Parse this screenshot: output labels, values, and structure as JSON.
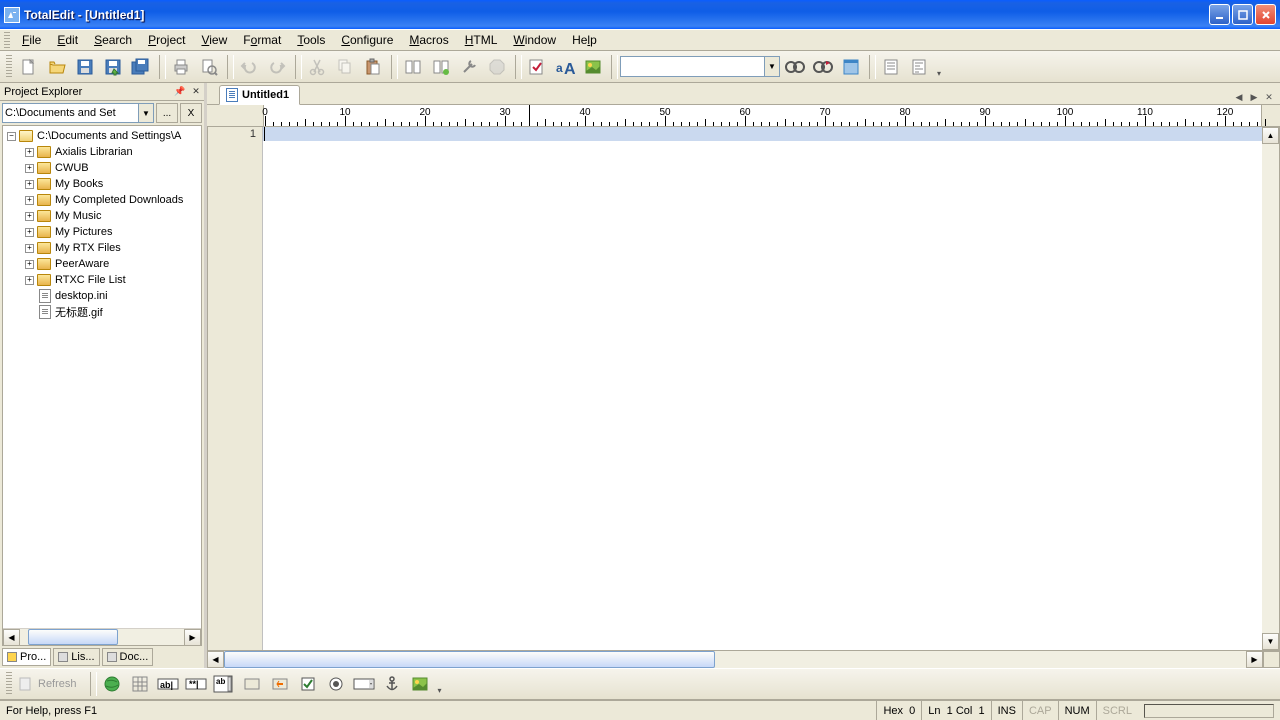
{
  "app": {
    "title": "TotalEdit - [Untitled1]"
  },
  "menu": {
    "items": [
      "File",
      "Edit",
      "Search",
      "Project",
      "View",
      "Format",
      "Tools",
      "Configure",
      "Macros",
      "HTML",
      "Window",
      "Help"
    ],
    "mnemonics": [
      "F",
      "E",
      "S",
      "P",
      "V",
      "o",
      "T",
      "C",
      "M",
      "H",
      "W",
      "l"
    ]
  },
  "toolbar1": {
    "combo_value": ""
  },
  "project_explorer": {
    "title": "Project Explorer",
    "path": "C:\\Documents and Set",
    "browse_label": "...",
    "x_label": "X",
    "root": "C:\\Documents and Settings\\A",
    "folders": [
      "Axialis Librarian",
      "CWUB",
      "My Books",
      "My Completed Downloads",
      "My Music",
      "My Pictures",
      "My RTX Files",
      "PeerAware",
      "RTXC File List"
    ],
    "files": [
      "desktop.ini",
      "无标题.gif"
    ]
  },
  "left_tabs": {
    "t1": "Pro...",
    "t2": "Lis...",
    "t3": "Doc..."
  },
  "editor": {
    "tab_label": "Untitled1",
    "line_number": "1",
    "ruler_labels": [
      "0",
      "10",
      "20",
      "30",
      "40",
      "50",
      "60",
      "70",
      "80",
      "90",
      "100",
      "110",
      "120"
    ]
  },
  "toolbar2": {
    "refresh": "Refresh"
  },
  "status": {
    "help": "For Help, press F1",
    "hex": "Hex",
    "hex_val": "0",
    "ln": "Ln",
    "ln_val": "1",
    "col": "Col",
    "col_val": "1",
    "ins": "INS",
    "cap": "CAP",
    "num": "NUM",
    "scrl": "SCRL"
  }
}
